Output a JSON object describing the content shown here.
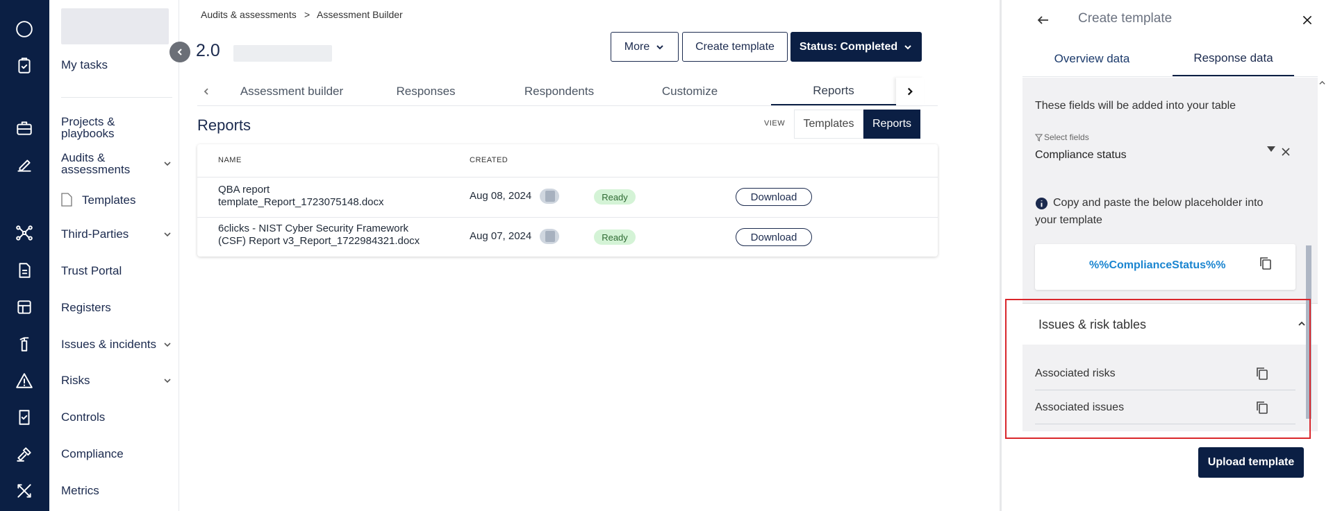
{
  "nav": {
    "my_tasks": "My tasks",
    "projects": "Projects & playbooks",
    "audits": "Audits & assessments",
    "templates": "Templates",
    "third_parties": "Third-Parties",
    "trust_portal": "Trust Portal",
    "registers": "Registers",
    "issues": "Issues & incidents",
    "risks": "Risks",
    "controls": "Controls",
    "compliance": "Compliance",
    "metrics": "Metrics"
  },
  "breadcrumb": {
    "item1": "Audits & assessments",
    "sep": ">",
    "item2": "Assessment Builder"
  },
  "header": {
    "version": "2.0",
    "more": "More",
    "create_template": "Create template",
    "status": "Status: Completed"
  },
  "tabs": [
    "Assessment builder",
    "Responses",
    "Respondents",
    "Customize",
    "Reports"
  ],
  "reports": {
    "title": "Reports",
    "view_label": "VIEW",
    "seg_templates": "Templates",
    "seg_reports": "Reports",
    "columns": {
      "name": "NAME",
      "created": "CREATED"
    },
    "rows": [
      {
        "name_l1": "QBA report",
        "name_l2": "template_Report_1723075148.docx",
        "created": "Aug 08, 2024",
        "status": "Ready",
        "action": "Download"
      },
      {
        "name_l1": "6clicks - NIST Cyber Security Framework",
        "name_l2": "(CSF) Report v3_Report_1722984321.docx",
        "created": "Aug 07, 2024",
        "status": "Ready",
        "action": "Download"
      }
    ]
  },
  "panel": {
    "title": "Create template",
    "tab_overview": "Overview data",
    "tab_response": "Response data",
    "fields_note": "These fields will be added into your table",
    "select_label": "Select fields",
    "select_value": "Compliance status",
    "info_l1": "Copy and paste the below placeholder into",
    "info_l2": "your template",
    "placeholder": "%%ComplianceStatus%%",
    "section_title": "Issues & risk tables",
    "items": [
      "Associated risks",
      "Associated issues"
    ],
    "upload": "Upload template"
  },
  "colors": {
    "navy": "#0b1f44",
    "accent_blue": "#1a85d0",
    "ready_bg": "#d4f3d6",
    "highlight": "#d9262b"
  }
}
